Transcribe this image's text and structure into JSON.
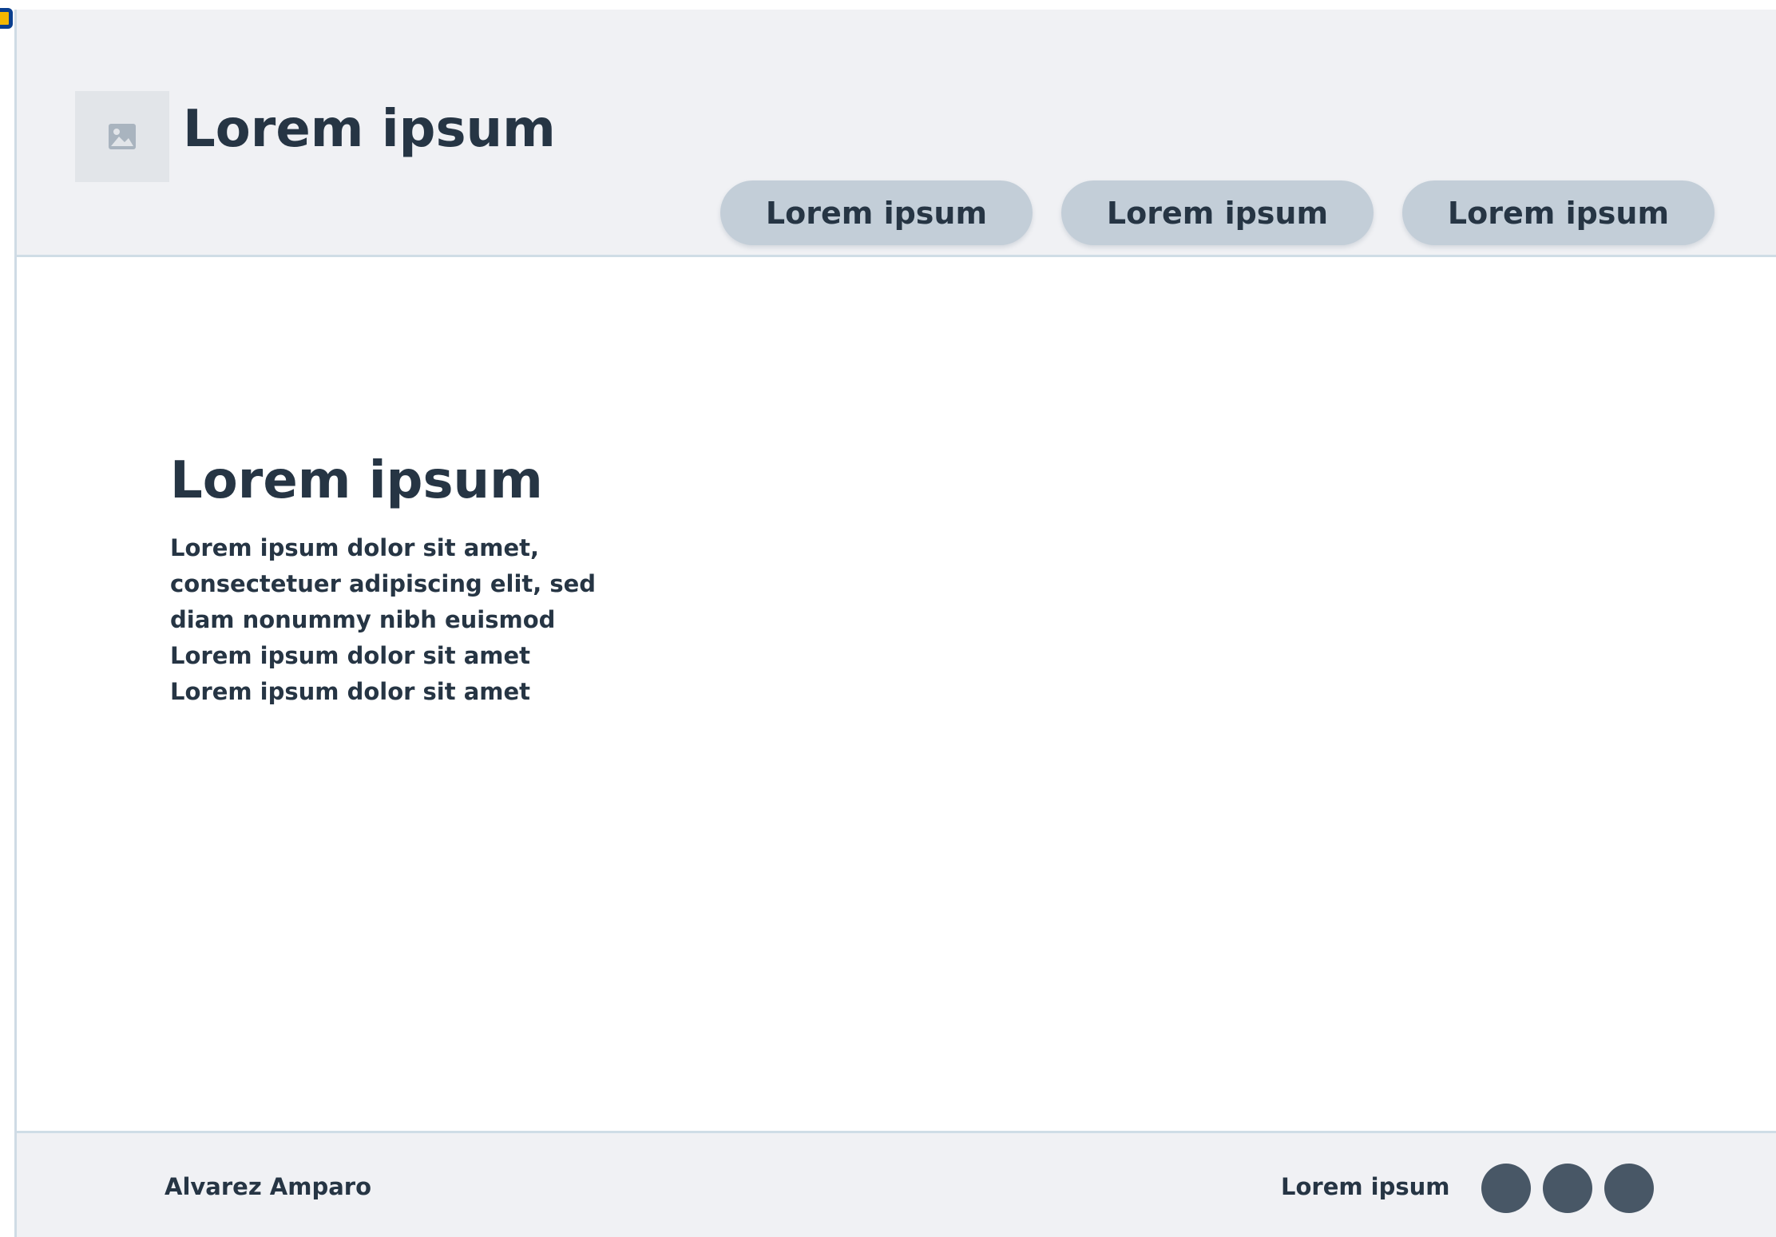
{
  "header": {
    "logo_icon": "image-placeholder-icon",
    "site_title": "Lorem ipsum",
    "nav": [
      {
        "label": "Lorem ipsum"
      },
      {
        "label": "Lorem ipsum"
      },
      {
        "label": "Lorem ipsum"
      }
    ]
  },
  "hero": {
    "title": "Lorem ipsum",
    "body": "Lorem ipsum dolor sit amet, consectetuer adipiscing  elit, sed diam nonummy nibh euismod  Lorem ipsum dolor sit amet  Lorem ipsum dolor sit amet"
  },
  "footer": {
    "author": "Alvarez Amparo",
    "link_label": "Lorem ipsum",
    "social_icons": [
      "social-icon",
      "social-icon",
      "social-icon"
    ]
  },
  "colors": {
    "header_bg": "#f0f1f4",
    "nav_button_bg": "#c3ced8",
    "text": "#263544",
    "social_dot": "#485766",
    "divider": "#cfdde6"
  }
}
